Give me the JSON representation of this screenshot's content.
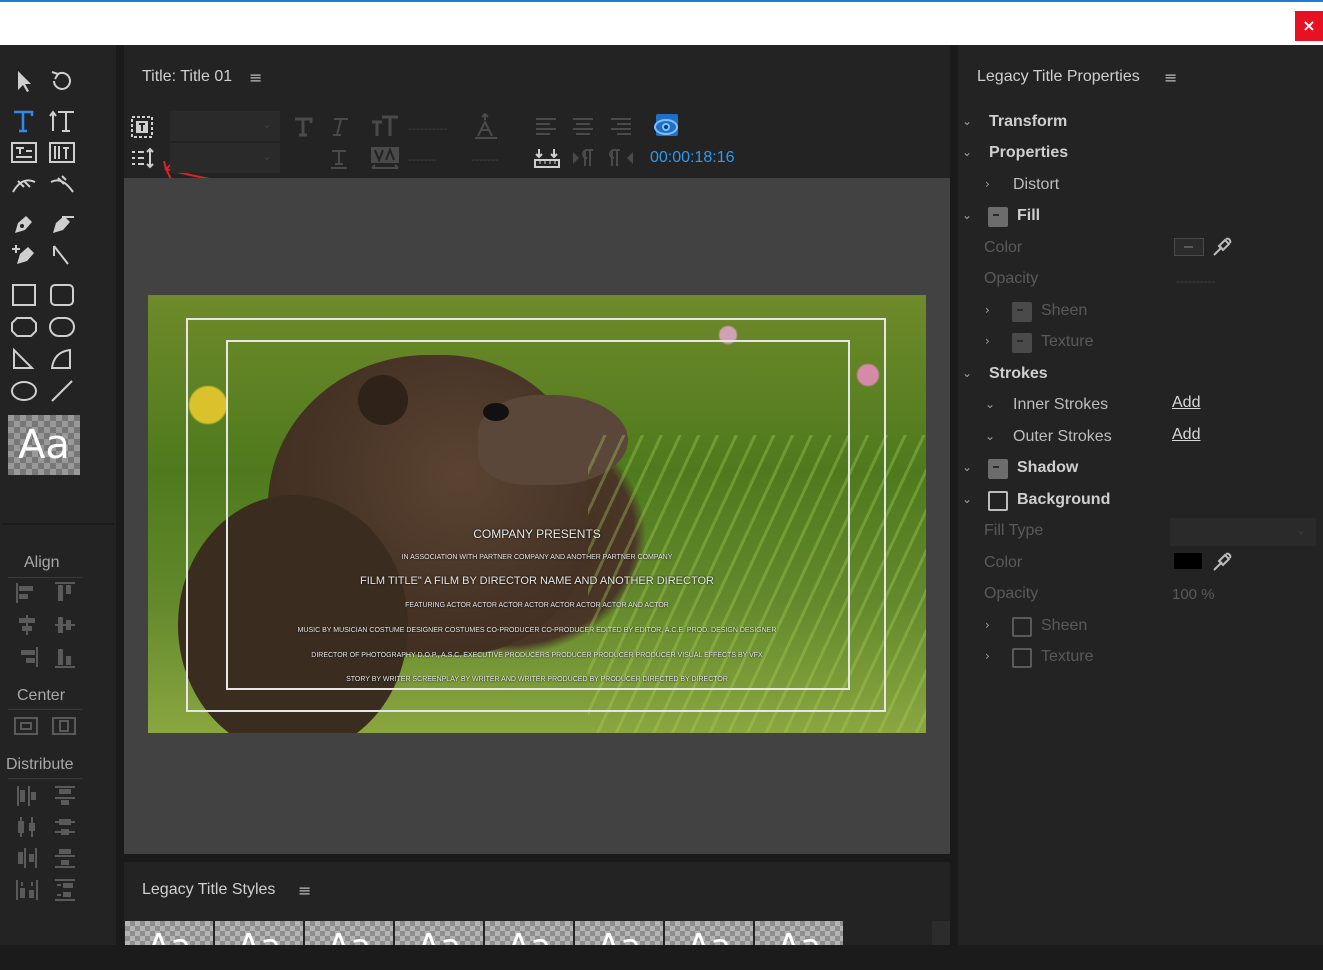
{
  "window": {
    "close_label": "×"
  },
  "title_panel": {
    "title": "Title: Title 01",
    "menu": "≡"
  },
  "toolbar": {
    "timecode": "00:00:18:16",
    "dashes1": "----------",
    "dashes2": "-------",
    "dashes3": "-------"
  },
  "tools": {
    "style_sample": "Aa",
    "align_label": "Align",
    "center_label": "Center",
    "distribute_label": "Distribute"
  },
  "credits": {
    "line1": "COMPANY PRESENTS",
    "line2": "IN ASSOCIATION WITH PARTNER COMPANY AND ANOTHER PARTNER COMPANY",
    "line3": "FILM TITLE\" A FILM BY DIRECTOR NAME AND ANOTHER DIRECTOR",
    "line4": "FEATURING ACTOR ACTOR ACTOR ACTOR ACTOR ACTOR ACTOR AND ACTOR",
    "line5": "MUSIC BY MUSICIAN COSTUME DESIGNER COSTUMES CO-PRODUCER CO-PRODUCER EDITED BY EDITOR, A.C.E. PROD. DESIGN DESIGNER",
    "line6": "DIRECTOR OF PHOTOGRAPHY D.O.P., A.S.C. EXECUTIVE PRODUCERS PRODUCER PRODUCER PRODUCER VISUAL EFFECTS BY VFX",
    "line7": "STORY BY WRITER SCREENPLAY BY WRITER AND WRITER PRODUCED BY PRODUCER DIRECTED BY DIRECTOR"
  },
  "properties": {
    "header": "Legacy Title Properties",
    "menu": "≡",
    "transform": "Transform",
    "properties": "Properties",
    "distort": "Distort",
    "fill": "Fill",
    "color": "Color",
    "opacity": "Opacity",
    "opacity_dashes": "----------",
    "sheen": "Sheen",
    "texture": "Texture",
    "strokes": "Strokes",
    "inner_strokes": "Inner Strokes",
    "outer_strokes": "Outer Strokes",
    "add": "Add",
    "shadow": "Shadow",
    "background": "Background",
    "fill_type": "Fill Type",
    "bg_color": "Color",
    "bg_opacity": "Opacity",
    "bg_opacity_value": "100 %",
    "bg_sheen": "Sheen",
    "bg_texture": "Texture",
    "bg_swatch_color": "#000000"
  },
  "styles_panel": {
    "title": "Legacy Title Styles",
    "menu": "≡",
    "thumb_label": "Aa"
  }
}
